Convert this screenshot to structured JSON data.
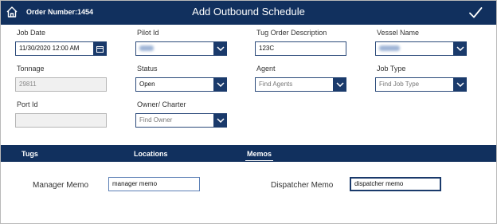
{
  "header": {
    "order_label": "Order Number:",
    "order_number": "1454",
    "title": "Add Outbound Schedule",
    "home_icon": "home-icon",
    "confirm_icon": "check-icon"
  },
  "fields": {
    "job_date": {
      "label": "Job Date",
      "value": "11/30/2020 12:00 AM"
    },
    "pilot_id": {
      "label": "Pilot Id"
    },
    "tug_order_description": {
      "label": "Tug Order Description",
      "value": "123C"
    },
    "vessel_name": {
      "label": "Vessel Name"
    },
    "tonnage": {
      "label": "Tonnage",
      "value": "29811"
    },
    "status": {
      "label": "Status",
      "value": "Open"
    },
    "agent": {
      "label": "Agent",
      "placeholder": "Find Agents"
    },
    "job_type": {
      "label": "Job Type",
      "placeholder": "Find Job Type"
    },
    "port_id": {
      "label": "Port Id",
      "value": ""
    },
    "owner_charter": {
      "label": "Owner/ Charter",
      "placeholder": "Find Owner"
    }
  },
  "tabs": [
    {
      "label": "Tugs"
    },
    {
      "label": "Locations"
    },
    {
      "label": "Memos",
      "active": true
    }
  ],
  "memos": {
    "manager": {
      "label": "Manager Memo",
      "value": "manager memo"
    },
    "dispatcher": {
      "label": "Dispatcher Memo",
      "value": "dispatcher memo"
    }
  },
  "colors": {
    "header_bg": "#11305e",
    "dropdown_button": "#1a3a6b",
    "field_border": "#2b4a7a"
  }
}
